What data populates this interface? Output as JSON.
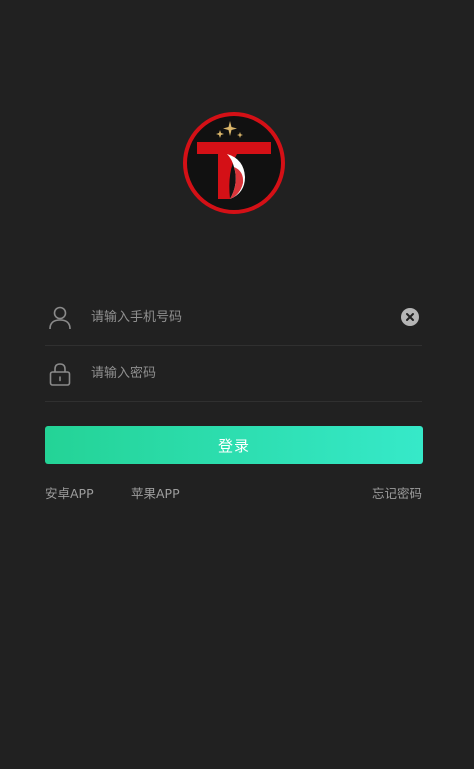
{
  "login_form": {
    "phone_placeholder": "请输入手机号码",
    "phone_value": "",
    "password_placeholder": "请输入密码",
    "password_value": "",
    "login_label": "登录"
  },
  "links": {
    "android_app": "安卓APP",
    "ios_app": "苹果APP",
    "forgot_password": "忘记密码"
  },
  "icons": {
    "logo": "app-logo-red-circle-T",
    "phone_field": "user-icon",
    "password_field": "lock-icon",
    "clear": "clear-icon"
  },
  "colors": {
    "background": "#212121",
    "button_gradient_start": "#24d396",
    "button_gradient_end": "#36e9c9",
    "logo_red": "#d41016"
  }
}
